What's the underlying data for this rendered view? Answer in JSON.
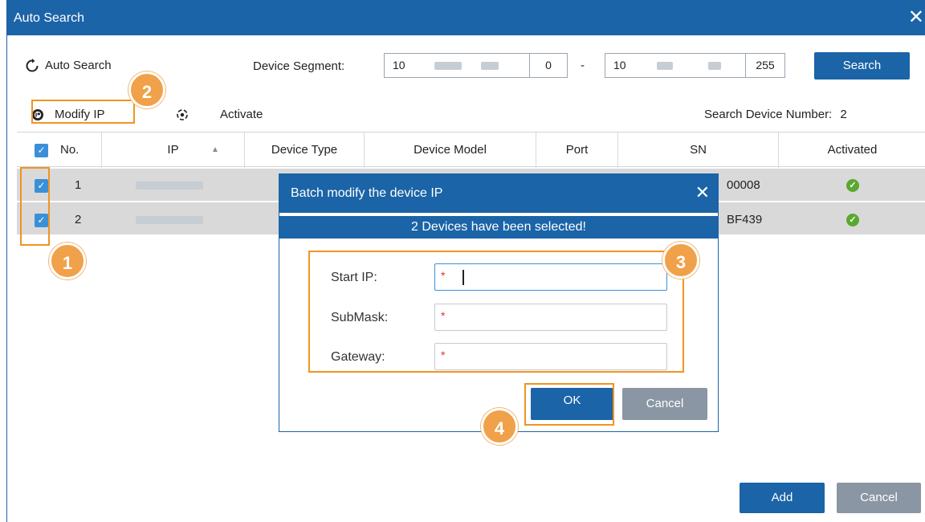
{
  "window": {
    "title": "Auto Search",
    "close_glyph": "✕"
  },
  "toolbar": {
    "auto_search_label": "Auto Search",
    "device_segment_label": "Device Segment:",
    "segment_start": [
      "10",
      "",
      "",
      "0"
    ],
    "segment_separator": "-",
    "segment_end": [
      "10",
      "",
      "",
      "255"
    ],
    "search_button": "Search",
    "modify_ip_label": "Modify IP",
    "activate_label": "Activate",
    "device_count_label": "Search Device Number:",
    "device_count": "2"
  },
  "table": {
    "headers": [
      "No.",
      "IP",
      "Device Type",
      "Device Model",
      "Port",
      "SN",
      "Activated"
    ],
    "rows": [
      {
        "no": "1",
        "sn_tail": "00008",
        "activated": true
      },
      {
        "no": "2",
        "sn_tail": "BF439",
        "activated": true
      }
    ]
  },
  "dialog": {
    "title": "Batch modify the device IP",
    "banner": "2 Devices have been selected!",
    "fields": [
      {
        "label": "Start IP:",
        "required_mark": "*"
      },
      {
        "label": "SubMask:",
        "required_mark": "*"
      },
      {
        "label": "Gateway:",
        "required_mark": "*"
      }
    ],
    "ok": "OK",
    "cancel": "Cancel"
  },
  "footer": {
    "add": "Add",
    "cancel": "Cancel"
  },
  "callouts": [
    "1",
    "2",
    "3",
    "4"
  ],
  "colors": {
    "primary": "#1b64a7",
    "highlight": "#f09421",
    "badge": "#f0a14a",
    "checkbox": "#3a90d8",
    "activated": "#5aa832"
  },
  "icons": [
    "refresh-icon",
    "modify-ip-icon",
    "activate-icon",
    "close-icon",
    "sort-asc-icon",
    "checkbox-icon",
    "activated-check-icon"
  ]
}
